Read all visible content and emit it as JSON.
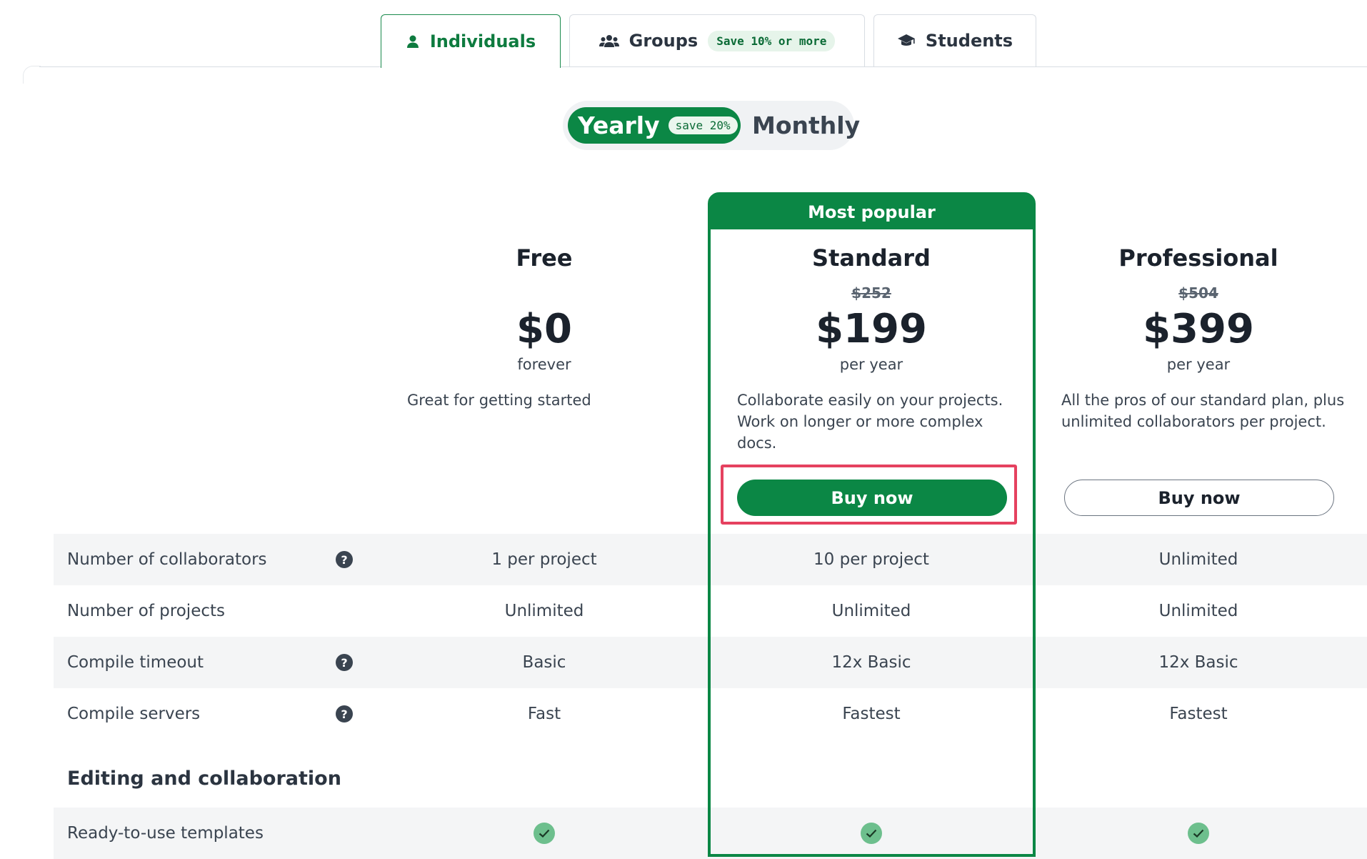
{
  "tabs": [
    {
      "label": "Individuals",
      "icon": "user-icon",
      "active": true
    },
    {
      "label": "Groups",
      "icon": "users-icon",
      "badge": "Save 10% or more"
    },
    {
      "label": "Students",
      "icon": "graduation-cap-icon"
    }
  ],
  "billing_toggle": {
    "yearly_label": "Yearly",
    "yearly_badge": "save 20%",
    "monthly_label": "Monthly",
    "selected": "Yearly"
  },
  "popular_banner": "Most popular",
  "plans": [
    {
      "name": "Free",
      "original_price": "",
      "price": "$0",
      "period": "forever",
      "description": "Great for getting started",
      "button": ""
    },
    {
      "name": "Standard",
      "original_price": "$252",
      "price": "$199",
      "period": "per year",
      "description": "Collaborate easily on your projects. Work on longer or more complex docs.",
      "button": "Buy now"
    },
    {
      "name": "Professional",
      "original_price": "$504",
      "price": "$399",
      "period": "per year",
      "description": "All the pros of our standard plan, plus unlimited collaborators per project.",
      "button": "Buy now"
    }
  ],
  "features": [
    {
      "label": "Number of collaborators",
      "help": true,
      "values": [
        "1 per project",
        "10 per project",
        "Unlimited"
      ]
    },
    {
      "label": "Number of projects",
      "help": false,
      "values": [
        "Unlimited",
        "Unlimited",
        "Unlimited"
      ]
    },
    {
      "label": "Compile timeout",
      "help": true,
      "values": [
        "Basic",
        "12x Basic",
        "12x Basic"
      ]
    },
    {
      "label": "Compile servers",
      "help": true,
      "values": [
        "Fast",
        "Fastest",
        "Fastest"
      ]
    }
  ],
  "sections": [
    {
      "title": "Editing and collaboration",
      "rows": [
        {
          "label": "Ready-to-use templates",
          "values": [
            "check",
            "check",
            "check"
          ]
        }
      ]
    }
  ],
  "help_glyph": "?",
  "colors": {
    "brand_green": "#0b8745",
    "highlight_red": "#e5415f",
    "check_green": "#6dbf8d"
  }
}
